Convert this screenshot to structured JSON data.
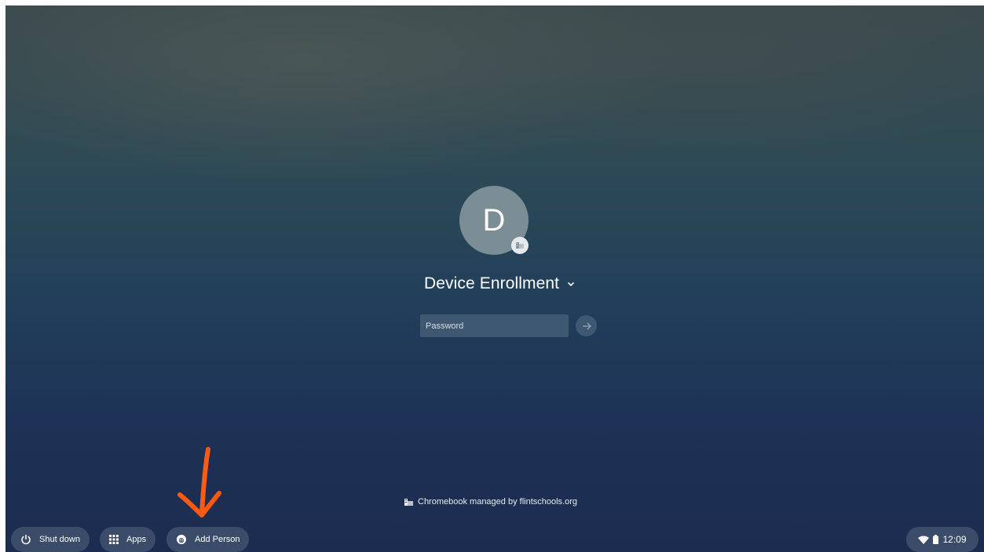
{
  "user": {
    "avatar_letter": "D",
    "name": "Device Enrollment",
    "badge_icon": "building-icon",
    "dropdown_icon": "chevron-down-icon"
  },
  "login": {
    "password_placeholder": "Password",
    "password_value": "",
    "submit_icon": "arrow-right-icon"
  },
  "management": {
    "text": "Chromebook managed by flintschools.org",
    "icon": "building-icon"
  },
  "shelf": {
    "shutdown_label": "Shut down",
    "apps_label": "Apps",
    "add_person_label": "Add Person"
  },
  "tray": {
    "time": "12:09",
    "icons": [
      "wifi-icon",
      "battery-icon"
    ]
  },
  "annotation": {
    "type": "hand-drawn arrow",
    "color": "#ff5a12",
    "points_to": "Add Person"
  },
  "colors": {
    "avatar_bg": "#7c8e95",
    "annotation_arrow": "#ff5a12",
    "text": "#ffffff"
  }
}
